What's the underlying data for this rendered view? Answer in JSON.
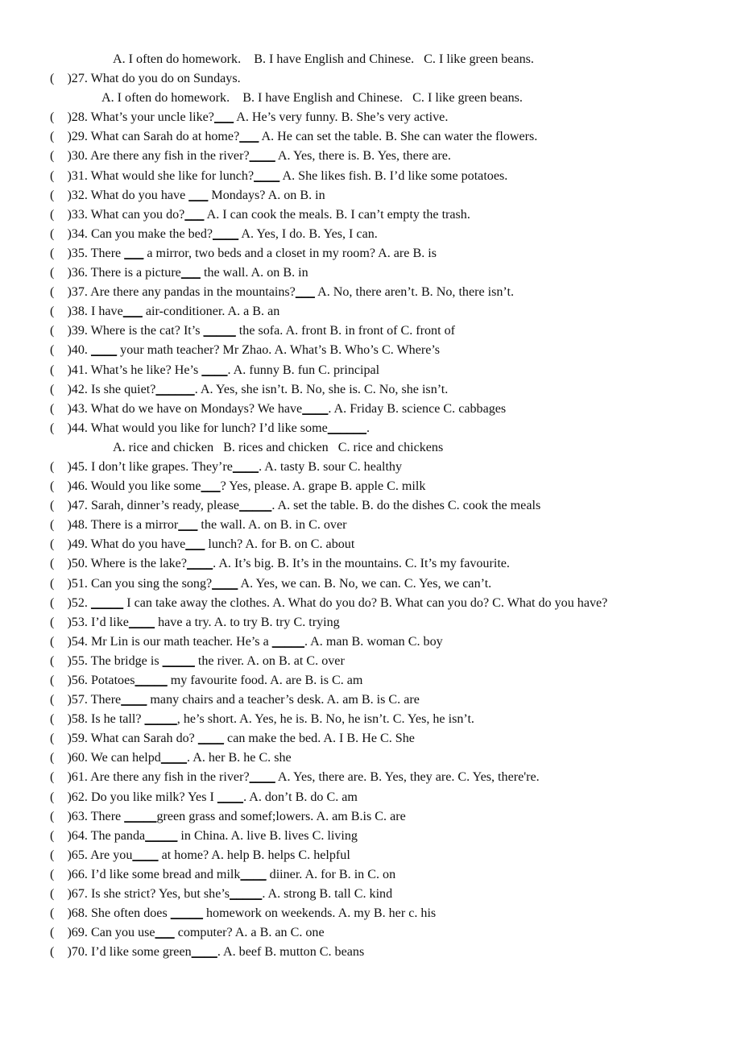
{
  "document": {
    "kind": "english-multiple-choice-worksheet",
    "paper_background": "#ffffff",
    "text_color": "#111111",
    "first_question_number": 27,
    "last_question_number": 70
  },
  "lines": [
    {
      "id": "l01",
      "type": "options-only",
      "indent": "indent-a",
      "text": "A. I often do homework.    B. I have English and Chinese.   C. I like green beans."
    },
    {
      "id": "l02",
      "type": "question",
      "marker": "(    )27.",
      "text": " What do you do on Sundays."
    },
    {
      "id": "l03",
      "type": "options-only",
      "indent": "indent-c",
      "text": "A. I often do homework.    B. I have English and Chinese.   C. I like green beans."
    },
    {
      "id": "l04",
      "type": "question",
      "marker": "(    )28.",
      "text": " What’s your uncle like?",
      "blank": "___",
      "tail": "    A. He’s very funny.   B. She’s very active."
    },
    {
      "id": "l05",
      "type": "question",
      "marker": "(    )29.",
      "text": " What can Sarah do at home?",
      "blank": "___",
      "tail": "    A. He can set the table.    B. She can water the flowers."
    },
    {
      "id": "l06",
      "type": "question",
      "marker": "(    )30.",
      "text": " Are there any fish in the river?",
      "blank": "____",
      "tail": "    A. Yes, there is.    B. Yes, there are."
    },
    {
      "id": "l07",
      "type": "question",
      "marker": "(    )31.",
      "text": " What would she like for lunch?",
      "blank": "____",
      "tail": "    A. She likes fish.   B. I’d like some potatoes."
    },
    {
      "id": "l08",
      "type": "question",
      "marker": "(    )32.",
      "text": " What do you have ",
      "blank": "___",
      "tail": " Mondays?   A. on   B. in"
    },
    {
      "id": "l09",
      "type": "question",
      "marker": "(    )33.",
      "text": " What can you do?",
      "blank": "___",
      "tail": "    A. I can cook the meals.    B. I can’t empty the trash."
    },
    {
      "id": "l10",
      "type": "question",
      "marker": "(    )34.",
      "text": " Can you make the bed?",
      "blank": "____",
      "tail": "    A. Yes, I do.    B. Yes, I can."
    },
    {
      "id": "l11",
      "type": "question",
      "marker": "(    )35.",
      "text": " There ",
      "blank": "___",
      "tail": " a mirror, two beds and a closet in my room?   A. are   B. is"
    },
    {
      "id": "l12",
      "type": "question",
      "marker": "(    )36.",
      "text": " There is a picture",
      "blank": "___",
      "tail": " the wall.  A. on  B. in"
    },
    {
      "id": "l13",
      "type": "question",
      "marker": "(    )37.",
      "text": " Are there any pandas in the mountains?",
      "blank": "___",
      "tail": "    A. No, there aren’t.    B. No, there isn’t."
    },
    {
      "id": "l14",
      "type": "question",
      "marker": "(    )38.",
      "text": " I have",
      "blank": "___",
      "tail": " air-conditioner.  A. a   B. an"
    },
    {
      "id": "l15",
      "type": "question",
      "marker": "(    )39.",
      "text": " Where is the cat? It’s ",
      "blank": "_____",
      "tail": " the sofa.   A. front   B. in front of   C. front of"
    },
    {
      "id": "l16",
      "type": "question",
      "marker": "(    )40.",
      "text": " ",
      "blank": "____",
      "tail": " your math teacher? Mr Zhao.  A. What’s  B. Who’s   C. Where’s"
    },
    {
      "id": "l17",
      "type": "question",
      "marker": "(    )41.",
      "text": " What’s he like? He’s ",
      "blank": "____",
      "tail": ".   A. funny   B. fun   C. principal"
    },
    {
      "id": "l18",
      "type": "question",
      "marker": "(    )42.",
      "text": " Is she quiet?",
      "blank": "______",
      "tail": ".   A. Yes, she isn’t.   B. No, she is.   C. No, she isn’t."
    },
    {
      "id": "l19",
      "type": "question",
      "marker": "(    )43.",
      "text": " What do we have on Mondays? We have",
      "blank": "____",
      "tail": ".  A. Friday   B. science   C. cabbages"
    },
    {
      "id": "l20",
      "type": "question",
      "marker": "(    )44.",
      "text": " What would you like for lunch? I’d like some",
      "blank": "______",
      "tail": "."
    },
    {
      "id": "l21",
      "type": "options-only",
      "indent": "indent-a",
      "text": "A. rice and chicken   B. rices and chicken   C. rice and chickens"
    },
    {
      "id": "l22",
      "type": "question",
      "marker": "(    )45.",
      "text": " I don’t like grapes. They’re",
      "blank": "____",
      "tail": ".   A. tasty   B. sour   C. healthy"
    },
    {
      "id": "l23",
      "type": "question",
      "marker": "(    )46.",
      "text": " Would you like some",
      "blank": "___",
      "tail": "? Yes, please.  A. grape   B. apple   C. milk"
    },
    {
      "id": "l24",
      "type": "question",
      "marker": "(    )47.",
      "text": " Sarah, dinner’s ready, please",
      "blank": "_____",
      "tail": ". A. set the table.   B. do the dishes  C. cook the meals"
    },
    {
      "id": "l25",
      "type": "question",
      "marker": "(    )48.",
      "text": " There is a mirror",
      "blank": "___",
      "tail": " the wall.  A. on   B. in   C. over"
    },
    {
      "id": "l26",
      "type": "question",
      "marker": "(    )49.",
      "text": " What do you have",
      "blank": "___",
      "tail": " lunch?  A. for   B. on   C. about"
    },
    {
      "id": "l27",
      "type": "question",
      "marker": "(    )50.",
      "text": " Where is the lake?",
      "blank": "____",
      "tail": ".   A. It’s big.   B. It’s in the mountains.   C. It’s my favourite."
    },
    {
      "id": "l28",
      "type": "question",
      "marker": "(    )51.",
      "text": " Can you sing the song?",
      "blank": "____",
      "tail": "   A. Yes, we can.    B. No, we can.    C. Yes, we can’t."
    },
    {
      "id": "l29",
      "type": "question-wrap",
      "marker": "(    )52.",
      "text": " ",
      "blank": "_____",
      "tail": "  I can take away the clothes.   A. What do you do?  B. What can you do?  C. What do you have?"
    },
    {
      "id": "l30",
      "type": "question",
      "marker": "(    )53.",
      "text": " I’d like",
      "blank": "____",
      "tail": " have a try.  A. to try   B. try   C. trying"
    },
    {
      "id": "l31",
      "type": "question",
      "marker": "(    )54.",
      "text": " Mr Lin is our math teacher. He’s a ",
      "blank": "_____",
      "tail": ".   A. man   B. woman   C. boy"
    },
    {
      "id": "l32",
      "type": "question",
      "marker": "(    )55.",
      "text": " The bridge is ",
      "blank": "_____",
      "tail": " the river.   A. on   B. at   C. over"
    },
    {
      "id": "l33",
      "type": "question",
      "marker": "(    )56.",
      "text": " Potatoes",
      "blank": "_____",
      "tail": " my favourite food.   A. are   B. is   C. am"
    },
    {
      "id": "l34",
      "type": "question",
      "marker": "(    )57.",
      "text": " There",
      "blank": "____",
      "tail": " many chairs and a teacher’s desk.   A. am  B. is   C. are"
    },
    {
      "id": "l35",
      "type": "question",
      "marker": "(    )58.",
      "text": " Is he tall? ",
      "blank": "_____",
      "tail": ", he’s short.   A. Yes, he is.   B. No, he isn’t.   C. Yes, he isn’t."
    },
    {
      "id": "l36",
      "type": "question",
      "marker": "(    )59.",
      "text": " What can Sarah do? ",
      "blank": "____",
      "tail": " can make the bed.   A. I   B. He   C. She"
    },
    {
      "id": "l37",
      "type": "question",
      "marker": "(    )60.",
      "text": " We can helpd",
      "blank": "____",
      "tail": ".   A. her   B. he   C. she"
    },
    {
      "id": "l38",
      "type": "question",
      "marker": "(    )61.",
      "text": " Are there any fish in the river?",
      "blank": "____",
      "tail": "   A. Yes, there are.   B. Yes, they are.   C. Yes, there're."
    },
    {
      "id": "l39",
      "type": "question",
      "marker": "(    )62.",
      "text": " Do you like milk? Yes I ",
      "blank": "____",
      "tail": ".   A. don’t   B. do   C. am"
    },
    {
      "id": "l40",
      "type": "question",
      "marker": "(    )63.",
      "text": " There ",
      "blank": "_____",
      "tail": "green grass and somef;lowers.   A. am   B.is   C. are"
    },
    {
      "id": "l41",
      "type": "question",
      "marker": "(    )64.",
      "text": " The panda",
      "blank": "_____",
      "tail": " in China.   A. live   B. lives   C. living"
    },
    {
      "id": "l42",
      "type": "question",
      "marker": "(    )65.",
      "text": " Are you",
      "blank": "____",
      "tail": " at home?  A. help   B. helps   C. helpful"
    },
    {
      "id": "l43",
      "type": "question",
      "marker": "(    )66.",
      "text": " I’d like some bread and milk",
      "blank": "____",
      "tail": " diiner.   A. for    B. in    C. on"
    },
    {
      "id": "l44",
      "type": "question",
      "marker": "(    )67.",
      "text": " Is she strict? Yes, but she’s",
      "blank": "_____",
      "tail": ".   A. strong    B. tall    C. kind"
    },
    {
      "id": "l45",
      "type": "question",
      "marker": "(    )68.",
      "text": " She often does ",
      "blank": "_____",
      "tail": " homework on weekends.   A. my   B. her    c. his"
    },
    {
      "id": "l46",
      "type": "question",
      "marker": "(    )69.",
      "text": " Can you use",
      "blank": "___",
      "tail": " computer?  A. a   B. an   C. one"
    },
    {
      "id": "l47",
      "type": "question",
      "marker": "(    )70.",
      "text": " I’d like some green",
      "blank": "____",
      "tail": ".  A. beef   B. mutton   C. beans"
    }
  ]
}
